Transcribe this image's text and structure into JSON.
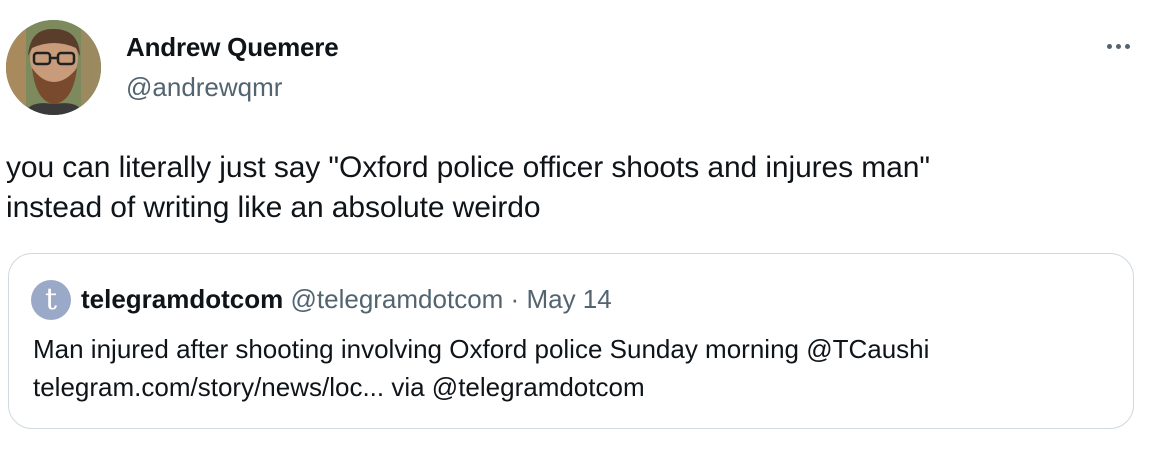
{
  "author": {
    "name": "Andrew Quemere",
    "handle": "@andrewqmr",
    "avatar_icon": "profile-photo"
  },
  "more_icon": "more-options-icon",
  "tweet": {
    "text_line1": "you can literally just say \"Oxford police officer shoots and injures man\"",
    "text_line2": "instead of writing like an absolute weirdo"
  },
  "quoted_tweet": {
    "avatar_letter": "t",
    "name": "telegramdotcom",
    "handle": "@telegramdotcom",
    "separator": "·",
    "date": "May 14",
    "text_line1": "Man injured after shooting involving Oxford police Sunday morning @TCaushi",
    "text_line2": "telegram.com/story/news/loc... via @telegramdotcom"
  }
}
